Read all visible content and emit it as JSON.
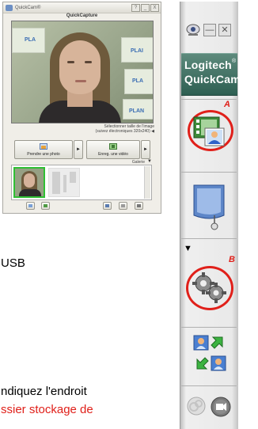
{
  "capture_window": {
    "title": "QuickCam®",
    "subtitle": "QuickCapture",
    "window_buttons": [
      "?",
      "_",
      "X"
    ],
    "preview_poster_texts": [
      "PLA",
      "PLAI",
      "PLA",
      "PLAN"
    ],
    "info_line_1": "Sélectionner taille de l'image",
    "info_line_2": "(suivez électroniques 320x240) ◀",
    "take_photo_label": "Prendre une photo",
    "record_video_label": "Enreg. une vidéo",
    "gallery_label": "Galerie",
    "gallery_dropdown": "▼"
  },
  "body_text": {
    "line_usb": "USB",
    "line_indiquez": "ndiquez l'endroit",
    "line_dossier": "ssier stockage de"
  },
  "toolbar": {
    "brand_line_1": "Logitech",
    "brand_line_2": "QuickCam",
    "reg_mark": "®",
    "minimize_label": "—",
    "close_label": "✕",
    "label_a": "A",
    "label_b": "B",
    "expand_triangle": "▼"
  },
  "colors": {
    "annotation_red": "#e0201a",
    "brand_green": "#3b6e60",
    "selected_thumb_border": "#2fbf34"
  }
}
